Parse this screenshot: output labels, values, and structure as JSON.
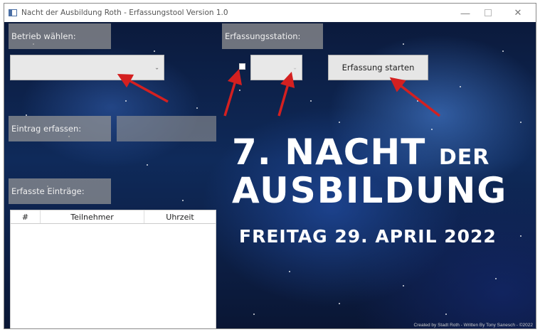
{
  "window": {
    "title": "Nacht der Ausbildung Roth - Erfassungstool Version 1.0",
    "controls": {
      "minimize": "—",
      "maximize": "",
      "close": "✕"
    }
  },
  "form": {
    "betrieb_label": "Betrieb wählen:",
    "betrieb_value": "",
    "station_label": "Erfassungsstation:",
    "station_value": "",
    "start_button": "Erfassung starten",
    "eintrag_label": "Eintrag erfassen:",
    "eintrag_value": "",
    "entries_label": "Erfasste Einträge:"
  },
  "table": {
    "columns": [
      "#",
      "Teilnehmer",
      "Uhrzeit"
    ],
    "rows": []
  },
  "poster": {
    "line1_big": "7. NACHT",
    "line1_small": "DER",
    "line2": "AUSBILDUNG",
    "line3": "FREITAG 29. APRIL 2022",
    "credits": "Created by Stadt Roth - Written By Tony Sanesch - ©2022"
  },
  "colors": {
    "arrow": "#d42020",
    "label_bg": "#969696",
    "background": "#0f2a5a"
  },
  "icons": {
    "app": "app-window-icon",
    "chevron": "chevron-down-icon"
  }
}
